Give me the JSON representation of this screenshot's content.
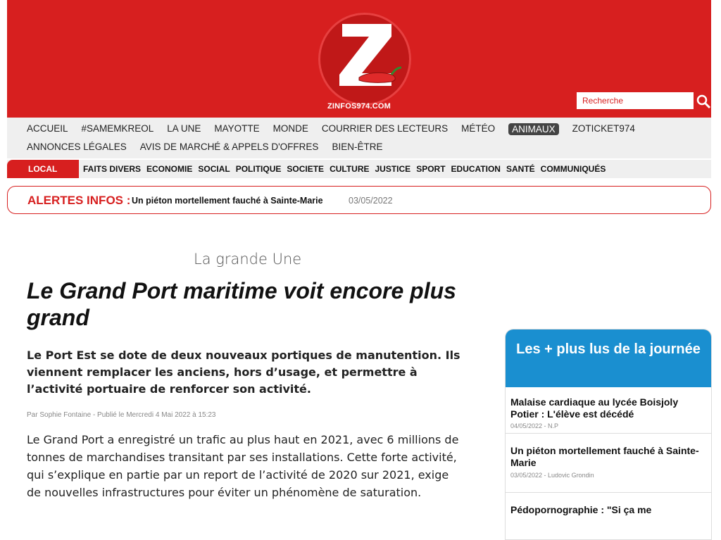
{
  "header": {
    "site_name": "ZINFOS974.COM",
    "brand_color": "#d71f1f",
    "search_placeholder": "Recherche"
  },
  "nav_main": {
    "row1": [
      "ACCUEIL",
      "#SAMEMKREOL",
      "LA UNE",
      "MAYOTTE",
      "MONDE",
      "COURRIER DES LECTEURS",
      "MÉTÉO",
      "ANIMAUX",
      "ZOTICKET974"
    ],
    "row2": [
      "ANNONCES LÉGALES",
      "AVIS DE MARCHÉ & APPELS D'OFFRES",
      "BIEN-ÊTRE"
    ],
    "active": "ANIMAUX"
  },
  "nav_sections": {
    "local": "LOCAL",
    "items": [
      "FAITS DIVERS",
      "ECONOMIE",
      "SOCIAL",
      "POLITIQUE",
      "SOCIETE",
      "CULTURE",
      "JUSTICE",
      "SPORT",
      "EDUCATION",
      "SANTÉ",
      "COMMUNIQUÉS"
    ]
  },
  "alerts": {
    "label": "ALERTES INFOS :",
    "title": "Un piéton mortellement fauché à Sainte-Marie",
    "date": "03/05/2022"
  },
  "article": {
    "section": "La grande Une",
    "headline": "Le Grand Port maritime voit encore plus grand",
    "lede": "Le Port Est se dote de deux nouveaux portiques de manutention. Ils viennent remplacer les anciens, hors d’usage, et permettre à l’activité portuaire de renforcer son activité.",
    "byline": "Par Sophie Fontaine - Publié le Mercredi 4 Mai 2022 à 15:23",
    "body": "Le Grand Port a enregistré un trafic au plus haut en 2021, avec 6 millions de tonnes de marchandises transitant par ses installations. Cette forte activité, qui s’explique en partie par un report de l’activité de 2020 sur 2021, exige de nouvelles infrastructures pour éviter un phénomène de saturation."
  },
  "sidebar": {
    "title": "Les + plus lus de la journée",
    "items": [
      {
        "title": "Malaise cardiaque au lycée Boisjoly Potier : L'élève est décédé",
        "meta": "04/05/2022 - N.P"
      },
      {
        "title": "Un piéton mortellement fauché à Sainte-Marie",
        "meta": "03/05/2022 - Ludovic Grondin"
      },
      {
        "title": "Pédopornographie : \"Si ça me",
        "meta": ""
      }
    ]
  }
}
